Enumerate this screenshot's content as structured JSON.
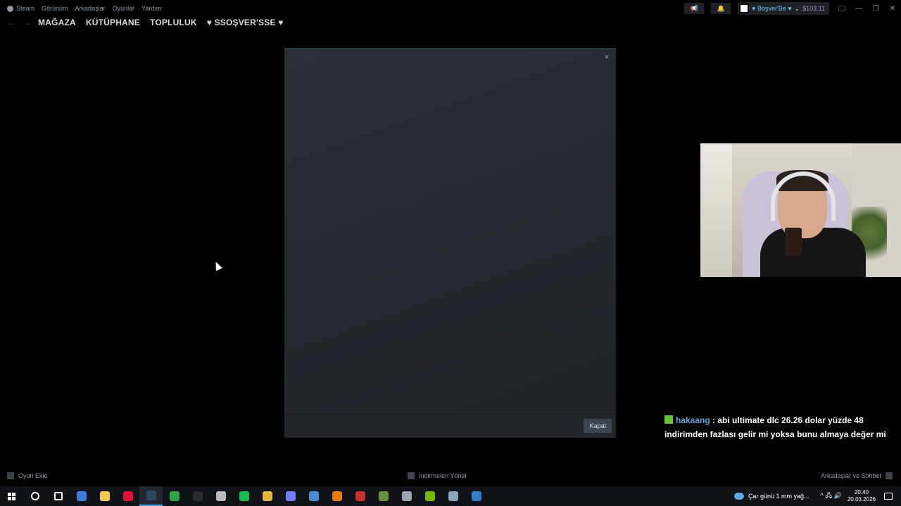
{
  "topmenu": {
    "steam": "Steam",
    "items": [
      "Görünüm",
      "Arkadaşlar",
      "Oyunlar",
      "Yardım"
    ]
  },
  "account": {
    "name": "♥ Boşver'Be ♥",
    "chevron": "⌄",
    "balance": "$103.11"
  },
  "icons": {
    "megaphone": "📢",
    "bell": "🔔",
    "monitor": "🖵",
    "minimize": "—",
    "restore": "❐",
    "close": "✕"
  },
  "nav": {
    "back": "←",
    "forward": "→",
    "links": [
      "MAĞAZA",
      "KÜTÜPHANE",
      "TOPLULUK",
      "♥ SSOŞVER'SSE ♥"
    ]
  },
  "modal": {
    "close_glyph": "×",
    "button_label": "Kapat"
  },
  "chat": {
    "user": "hakaang",
    "message": ": abi ultimate dlc 26.26 dolar yüzde 48 indirimden fazlası gelir mi yoksa bunu almaya değer mi"
  },
  "bottombar": {
    "add_game": "Oyun Ekle",
    "downloads": "İndirmeleri Yönet",
    "friends": "Arkadaşlar ve Sohbet"
  },
  "taskbar": {
    "apps": [
      {
        "name": "search",
        "color": "#ffffff"
      },
      {
        "name": "task-view",
        "color": "#ffffff"
      },
      {
        "name": "copilot",
        "color": "#3a7bd5"
      },
      {
        "name": "file-explorer",
        "color": "#f2c94c"
      },
      {
        "name": "opera",
        "color": "#e0113b"
      },
      {
        "name": "steam",
        "color": "#2a475e"
      },
      {
        "name": "xbox",
        "color": "#2ca243"
      },
      {
        "name": "epic",
        "color": "#2b2b2b"
      },
      {
        "name": "app-circle",
        "color": "#bbbbbb"
      },
      {
        "name": "spotify",
        "color": "#1db954"
      },
      {
        "name": "chrome",
        "color": "#e4b43c"
      },
      {
        "name": "discord-like",
        "color": "#6f7bf7"
      },
      {
        "name": "app-blue",
        "color": "#4a8bd1"
      },
      {
        "name": "blender",
        "color": "#e87d0d"
      },
      {
        "name": "app-red",
        "color": "#c53030"
      },
      {
        "name": "minecraft",
        "color": "#6b8e3a"
      },
      {
        "name": "app-tool",
        "color": "#9aa5b1"
      },
      {
        "name": "nvidia",
        "color": "#76b900"
      },
      {
        "name": "app-boat",
        "color": "#8fa3b8"
      },
      {
        "name": "app-tb",
        "color": "#2f7dc8"
      }
    ],
    "weather": "Çar günü 1 mm yağ...",
    "tray_glyphs": "^ 🖧 🔊",
    "time": "20:40",
    "date": "20.03.2026"
  }
}
